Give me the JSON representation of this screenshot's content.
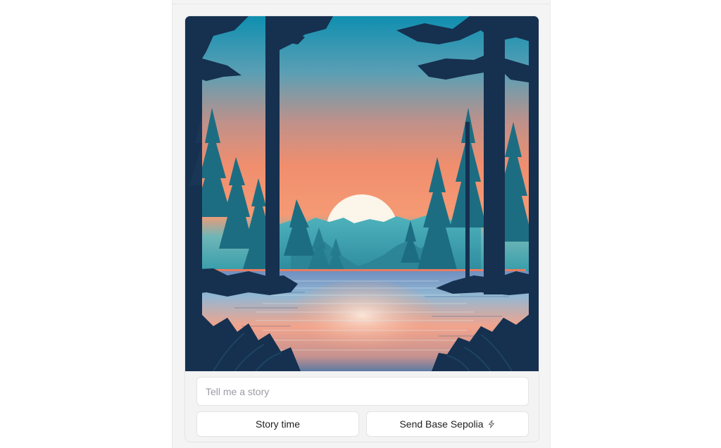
{
  "frame": {
    "image_alt": "Illustration of a sunset over a forest lake framed by pine trees",
    "input": {
      "placeholder": "Tell me a story",
      "value": ""
    },
    "buttons": [
      {
        "label": "Story time"
      },
      {
        "label": "Send Base Sepolia",
        "icon": "lightning-bolt-icon"
      }
    ]
  },
  "colors": {
    "sky_top": "#1590b0",
    "sky_glow": "#f48d6d",
    "sun": "#fbf5ea",
    "tree_dark": "#16304f",
    "tree_mid": "#1d6d82",
    "water": "#8ea6c9",
    "panel_bg": "#f4f4f5",
    "border": "#e4e4e7"
  }
}
